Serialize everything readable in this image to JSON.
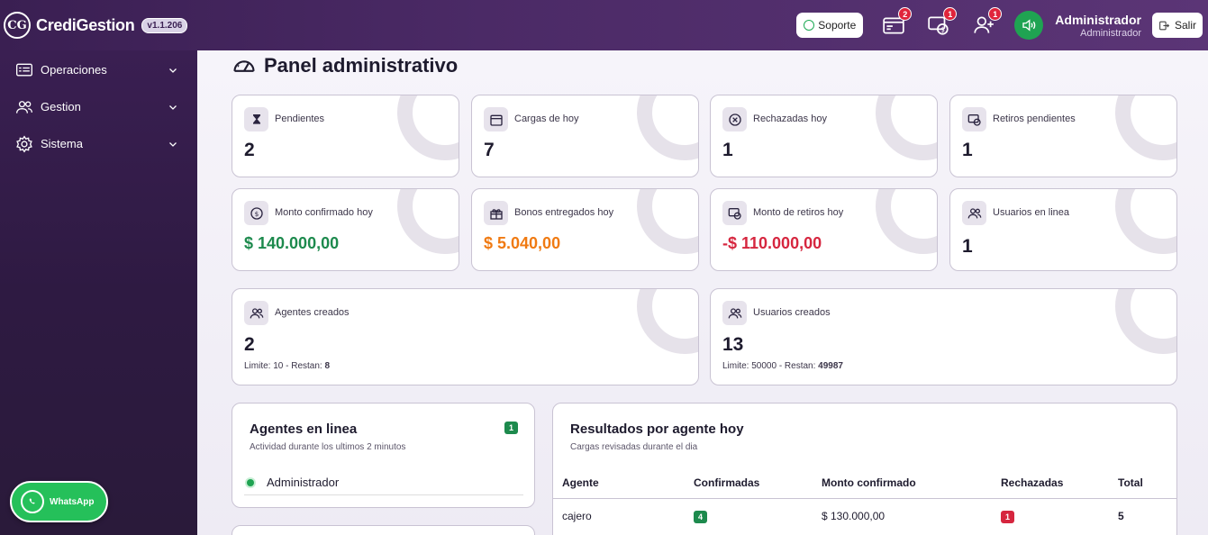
{
  "header": {
    "brand": "CrediGestion",
    "logo_text": "CG",
    "version": "v1.1.206",
    "soporte_label": "Soporte",
    "notifications": [
      {
        "name": "cargas-icon",
        "count": "2"
      },
      {
        "name": "retiros-icon",
        "count": "1"
      },
      {
        "name": "users-icon",
        "count": "1"
      }
    ],
    "user_name": "Administrador",
    "user_role": "Administrador",
    "salir_label": "Salir"
  },
  "sidebar": {
    "items": [
      {
        "label": "Operaciones",
        "icon": "monitor-icon"
      },
      {
        "label": "Gestion",
        "icon": "users-icon"
      },
      {
        "label": "Sistema",
        "icon": "gear-icon"
      }
    ],
    "whatsapp_label": "WhatsApp"
  },
  "main": {
    "title": "Panel administrativo",
    "cards": [
      {
        "label": "Pendientes",
        "value": "2",
        "icon": "hourglass-icon"
      },
      {
        "label": "Cargas de hoy",
        "value": "7",
        "icon": "calendar-icon"
      },
      {
        "label": "Rechazadas hoy",
        "value": "1",
        "icon": "x-circle-icon"
      },
      {
        "label": "Retiros pendientes",
        "value": "1",
        "icon": "cash-clock-icon"
      },
      {
        "label": "Monto confirmado hoy",
        "value": "$ 140.000,00",
        "icon": "dollar-circle-icon"
      },
      {
        "label": "Bonos entregados hoy",
        "value": "$ 5.040,00",
        "icon": "gift-icon"
      },
      {
        "label": "Monto de retiros hoy",
        "value": "-$ 110.000,00",
        "icon": "cash-icon"
      },
      {
        "label": "Usuarios en linea",
        "value": "1",
        "icon": "users-icon"
      }
    ],
    "wide_cards": [
      {
        "label": "Agentes creados",
        "value": "2",
        "sub_prefix": "Limite: 10 - Restan: ",
        "sub_value": "8",
        "icon": "users-icon"
      },
      {
        "label": "Usuarios creados",
        "value": "13",
        "sub_prefix": "Limite: 50000 - Restan: ",
        "sub_value": "49987",
        "icon": "users-icon"
      }
    ],
    "agents_online": {
      "title": "Agentes en linea",
      "subtitle": "Actividad durante los ultimos 2 minutos",
      "count": "1",
      "rows": [
        "Administrador"
      ]
    },
    "results": {
      "title": "Resultados por agente hoy",
      "subtitle": "Cargas revisadas durante el dia",
      "columns": [
        "Agente",
        "Confirmadas",
        "Monto confirmado",
        "Rechazadas",
        "Total"
      ],
      "rows": [
        {
          "agente": "cajero",
          "confirmadas": "4",
          "monto": "$ 130.000,00",
          "rechazadas": "1",
          "total": "5"
        }
      ]
    }
  }
}
